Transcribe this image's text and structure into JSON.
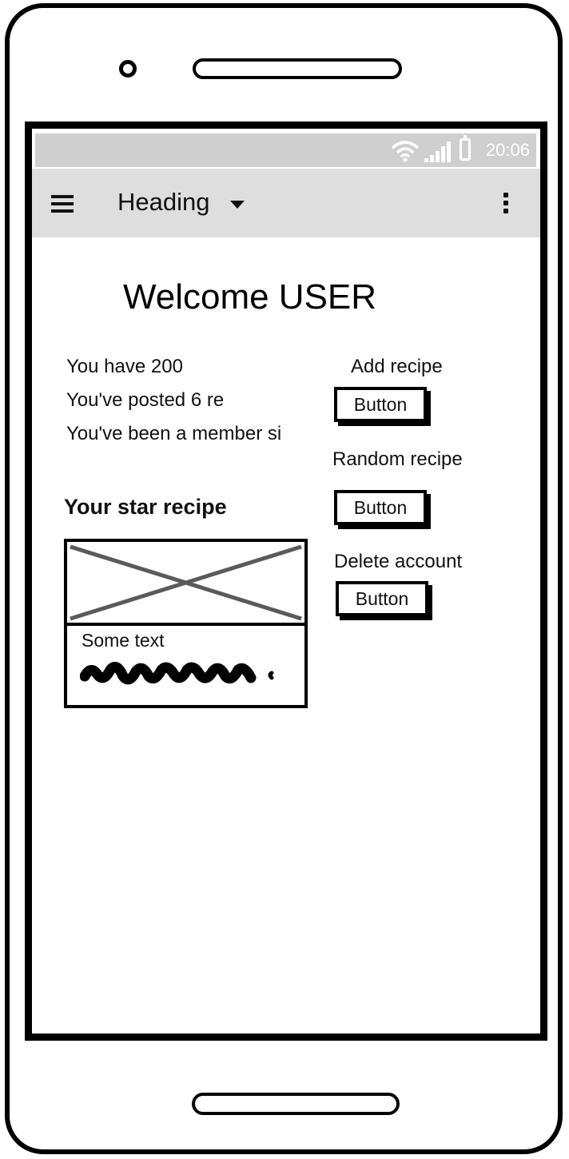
{
  "statusbar": {
    "time": "20:06",
    "icons": [
      "wifi-icon",
      "signal-icon",
      "battery-icon"
    ]
  },
  "appbar": {
    "menu_icon": "hamburger-menu-icon",
    "title": "Heading",
    "dropdown_icon": "caret-down-icon",
    "overflow_icon": "more-vertical-icon"
  },
  "main": {
    "welcome": "Welcome USER",
    "stats": [
      "You have 200",
      "You've posted 6 re",
      "You've been a member si"
    ],
    "star_heading": "Your star recipe",
    "card": {
      "image": "image-placeholder",
      "text": "Some text"
    }
  },
  "actions": [
    {
      "label": "Add recipe",
      "button": "Button"
    },
    {
      "label": "Random recipe",
      "button": "Button"
    },
    {
      "label": "Delete account",
      "button": "Button"
    }
  ],
  "colors": {
    "statusbar_bg": "#cfcfcf",
    "appbar_bg": "#dedede",
    "outline": "#000000",
    "placeholder_cross": "#5a5a5a"
  }
}
